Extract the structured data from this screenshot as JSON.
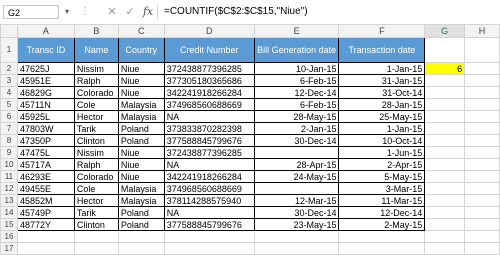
{
  "formula_bar": {
    "name_box": "G2",
    "cancel_icon": "✕",
    "enter_icon": "✓",
    "fx_label": "fx",
    "formula": "=COUNTIF($C$2:$C$15,\"Niue\")"
  },
  "columns": [
    "A",
    "B",
    "C",
    "D",
    "E",
    "F",
    "G",
    "H"
  ],
  "rows": [
    "1",
    "2",
    "3",
    "4",
    "5",
    "6",
    "7",
    "8",
    "9",
    "10",
    "11",
    "12",
    "13",
    "14",
    "15",
    "16",
    "17"
  ],
  "headers": [
    "Transc ID",
    "Name",
    "Country",
    "Credit Number",
    "Bill Generation date",
    "Transaction date"
  ],
  "data_rows": [
    [
      "47625J",
      "Nissim",
      "Niue",
      "372438877396285",
      "10-Jan-15",
      "1-Jan-15"
    ],
    [
      "45951E",
      "Ralph",
      "Niue",
      "377305180365686",
      "6-Feb-15",
      "31-Jan-15"
    ],
    [
      "46829G",
      "Colorado",
      "Niue",
      "342241918266284",
      "12-Dec-14",
      "31-Oct-14"
    ],
    [
      "45711N",
      "Cole",
      "Malaysia",
      "374968560688669",
      "6-Feb-15",
      "28-Jan-15"
    ],
    [
      "45925L",
      "Hector",
      "Malaysia",
      "NA",
      "28-May-15",
      "25-May-15"
    ],
    [
      "47803W",
      "Tarik",
      "Poland",
      "373833870282398",
      "2-Jan-15",
      "1-Jan-15"
    ],
    [
      "47350P",
      "Clinton",
      "Poland",
      "377588845799676",
      "30-Dec-14",
      "10-Oct-14"
    ],
    [
      "47475L",
      "Nissim",
      "Niue",
      "372438877396285",
      "",
      "1-Jun-15"
    ],
    [
      "45717A",
      "Ralph",
      "Niue",
      "NA",
      "28-Apr-15",
      "2-Apr-15"
    ],
    [
      "46293E",
      "Colorado",
      "Niue",
      "342241918266284",
      "24-May-15",
      "5-May-15"
    ],
    [
      "49455E",
      "Cole",
      "Malaysia",
      "374968560688669",
      "",
      "3-Mar-15"
    ],
    [
      "45852M",
      "Hector",
      "Malaysia",
      "378114288575940",
      "12-Mar-15",
      "11-Mar-15"
    ],
    [
      "45749P",
      "Tarik",
      "Poland",
      "NA",
      "30-Dec-14",
      "12-Dec-14"
    ],
    [
      "48772Y",
      "Clinton",
      "Poland",
      "377588845799676",
      "23-May-15",
      "2-May-15"
    ]
  ],
  "result_value": "6",
  "colors": {
    "header_fill": "#5b9bd5",
    "highlight": "#ffff00"
  }
}
